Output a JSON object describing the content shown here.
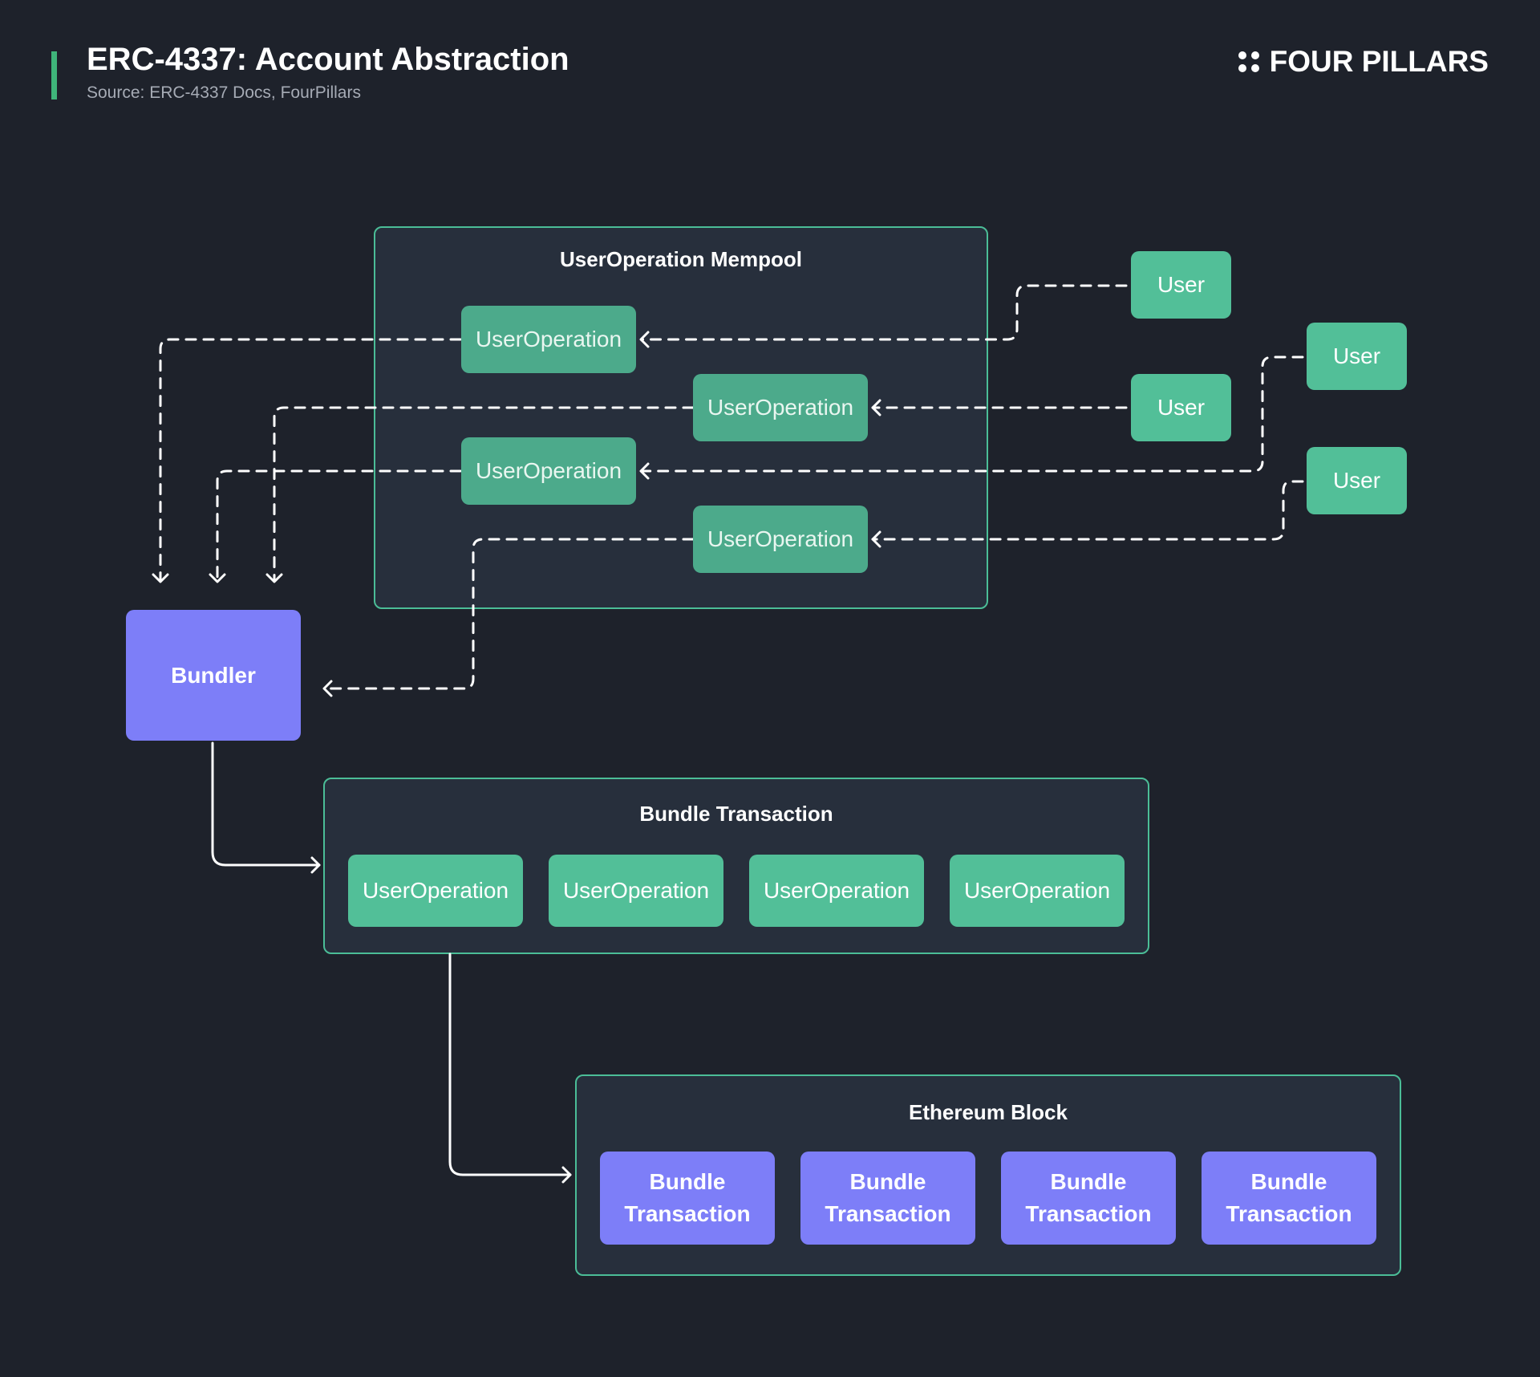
{
  "header": {
    "title": "ERC-4337: Account Abstraction",
    "source": "Source: ERC-4337 Docs, FourPillars",
    "brand": "FOUR PILLARS"
  },
  "mempool": {
    "title": "UserOperation Mempool",
    "operations": [
      "UserOperation",
      "UserOperation",
      "UserOperation",
      "UserOperation"
    ]
  },
  "users": [
    "User",
    "User",
    "User",
    "User"
  ],
  "bundler": {
    "label": "Bundler"
  },
  "bundle_transaction": {
    "title": "Bundle Transaction",
    "operations": [
      "UserOperation",
      "UserOperation",
      "UserOperation",
      "UserOperation"
    ]
  },
  "ethereum_block": {
    "title": "Ethereum Block",
    "transactions": [
      "Bundle\nTransaction",
      "Bundle\nTransaction",
      "Bundle\nTransaction",
      "Bundle\nTransaction"
    ]
  },
  "colors": {
    "background": "#1e222b",
    "container": "#272f3c",
    "accent_green": "#52bf98",
    "accent_purple": "#7d7ef8",
    "connector": "#ffffff"
  }
}
